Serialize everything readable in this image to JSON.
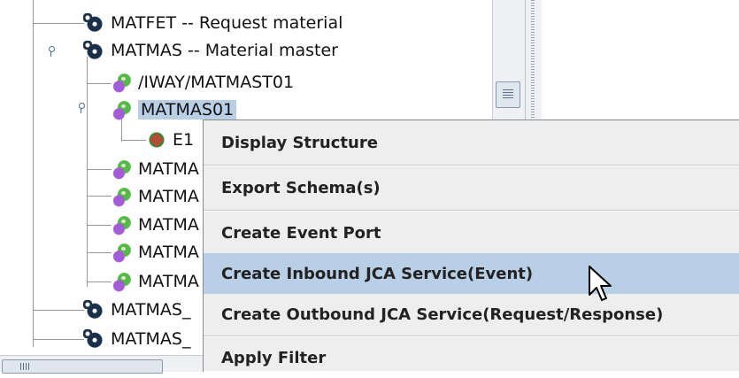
{
  "tree": {
    "items": [
      {
        "label": "MATFET -- Request material",
        "icon": "idoc-type-icon"
      },
      {
        "label": "MATMAS -- Material master",
        "icon": "idoc-type-icon"
      },
      {
        "label": "/IWAY/MATMAST01",
        "icon": "idoc-icon"
      },
      {
        "label": "MATMAS01",
        "icon": "idoc-icon"
      },
      {
        "label": "E1",
        "icon": "segment-icon"
      },
      {
        "label": "MATMA",
        "icon": "idoc-icon"
      },
      {
        "label": "MATMA",
        "icon": "idoc-icon"
      },
      {
        "label": "MATMA",
        "icon": "idoc-icon"
      },
      {
        "label": "MATMA",
        "icon": "idoc-icon"
      },
      {
        "label": "MATMA",
        "icon": "idoc-icon"
      },
      {
        "label": "MATMAS_",
        "icon": "idoc-type-icon"
      },
      {
        "label": "MATMAS_",
        "icon": "idoc-type-icon"
      }
    ],
    "selected_label": "MATMAS01"
  },
  "context_menu": {
    "items": [
      {
        "label": "Display Structure"
      },
      {
        "label": "Export Schema(s)"
      },
      {
        "label": "Create Event Port"
      },
      {
        "label": "Create Inbound JCA Service(Event)"
      },
      {
        "label": "Create Outbound JCA Service(Request/Response)"
      },
      {
        "label": "Apply Filter"
      }
    ],
    "highlighted_index": 3,
    "highlight_color": "#b8cfe5"
  },
  "colors": {
    "selection": "#b8cfe5",
    "menu_bg": "#eeeeee"
  }
}
